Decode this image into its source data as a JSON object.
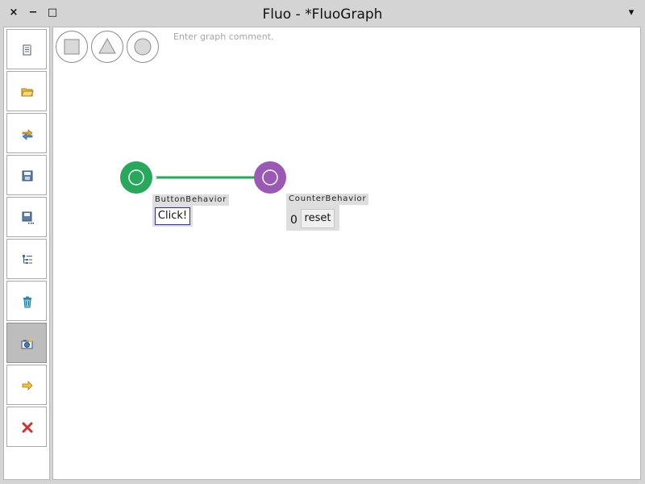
{
  "window": {
    "title": "Fluo - *FluoGraph",
    "close_glyph": "×",
    "minimize_glyph": "−",
    "maximize_glyph": "□",
    "menu_glyph": "▾"
  },
  "toolbar": {
    "buttons": [
      {
        "icon": "new-document-icon"
      },
      {
        "icon": "open-folder-icon"
      },
      {
        "icon": "refresh-icon"
      },
      {
        "icon": "save-icon"
      },
      {
        "icon": "save-as-icon"
      },
      {
        "icon": "tree-list-icon"
      },
      {
        "icon": "trash-icon"
      },
      {
        "icon": "camera-icon",
        "active": true
      },
      {
        "icon": "arrow-right-icon"
      },
      {
        "icon": "close-red-icon"
      }
    ]
  },
  "palette": {
    "shapes": [
      "square-shape-icon",
      "triangle-shape-icon",
      "circle-shape-icon"
    ]
  },
  "canvas": {
    "comment_placeholder": "Enter graph comment."
  },
  "nodes": {
    "button_behavior": {
      "label": "ButtonBehavior",
      "button_text": "Click!",
      "color": "#27a85a"
    },
    "counter_behavior": {
      "label": "CounterBehavior",
      "value": "0",
      "reset_text": "reset",
      "color": "#9b59b6"
    }
  },
  "colors": {
    "edge": "#27a85a"
  }
}
